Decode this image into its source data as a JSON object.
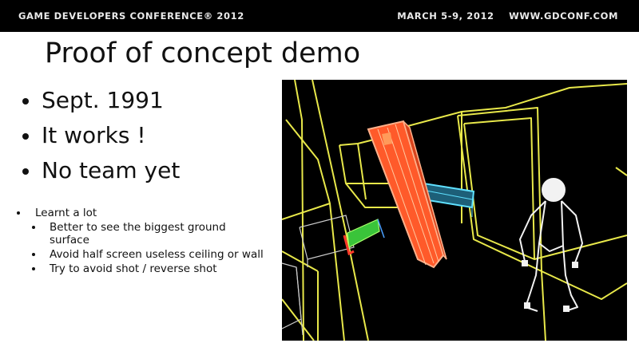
{
  "header": {
    "left_text": "GAME DEVELOPERS CONFERENCE® 2012",
    "date": "MARCH 5-9, 2012",
    "url": "WWW.GDCONF.COM"
  },
  "slide": {
    "title": "Proof of concept demo",
    "main_bullets": [
      "Sept. 1991",
      "It works !",
      "No team yet"
    ],
    "sub": {
      "label": "Learnt a lot",
      "items": [
        "Better to see the biggest ground surface",
        "Avoid half screen useless ceiling or wall",
        "Try to avoid shot / reverse shot"
      ]
    }
  },
  "demo_image": {
    "description": "wireframe 3D scene with yellow room edges, red tilted slab, cyan bar, green bench, white stick figure",
    "colors": {
      "background": "#000000",
      "walls": "#e8e84a",
      "slab": "#ff5a2a",
      "bar": "#33b8d8",
      "bench": "#3cc83c",
      "figure": "#f2f2f2"
    }
  }
}
